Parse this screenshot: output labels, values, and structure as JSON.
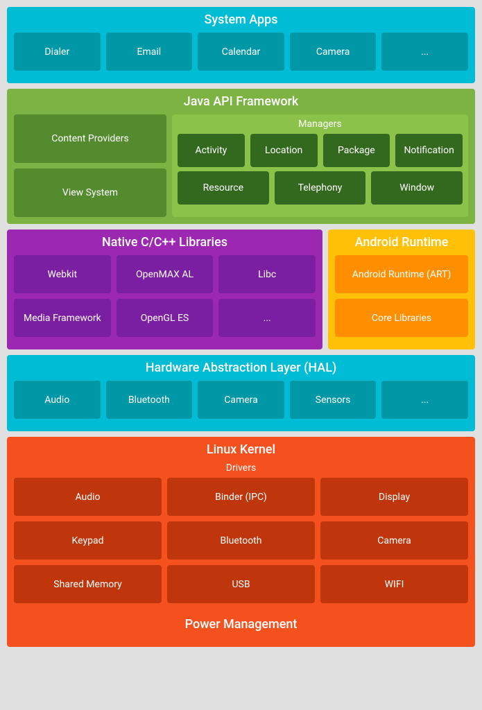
{
  "systemApps": {
    "title": "System Apps",
    "items": [
      "Dialer",
      "Email",
      "Calendar",
      "Camera",
      "..."
    ]
  },
  "javaApi": {
    "title": "Java API Framework",
    "leftItems": [
      "Content Providers",
      "View System"
    ],
    "managersTitle": "Managers",
    "managerRow1": [
      "Activity",
      "Location",
      "Package",
      "Notification"
    ],
    "managerRow2": [
      "Resource",
      "Telephony",
      "Window"
    ]
  },
  "native": {
    "title": "Native C/C++ Libraries",
    "row1": [
      "Webkit",
      "OpenMAX AL",
      "Libc"
    ],
    "row2": [
      "Media Framework",
      "OpenGL ES",
      "..."
    ]
  },
  "androidRuntime": {
    "title": "Android Runtime",
    "items": [
      "Android Runtime (ART)",
      "Core Libraries"
    ]
  },
  "hal": {
    "title": "Hardware Abstraction Layer (HAL)",
    "items": [
      "Audio",
      "Bluetooth",
      "Camera",
      "Sensors",
      "..."
    ]
  },
  "linux": {
    "title": "Linux Kernel",
    "driversLabel": "Drivers",
    "row1": [
      "Audio",
      "Binder (IPC)",
      "Display"
    ],
    "row2": [
      "Keypad",
      "Bluetooth",
      "Camera"
    ],
    "row3": [
      "Shared Memory",
      "USB",
      "WIFI"
    ],
    "powerLabel": "Power Management"
  }
}
